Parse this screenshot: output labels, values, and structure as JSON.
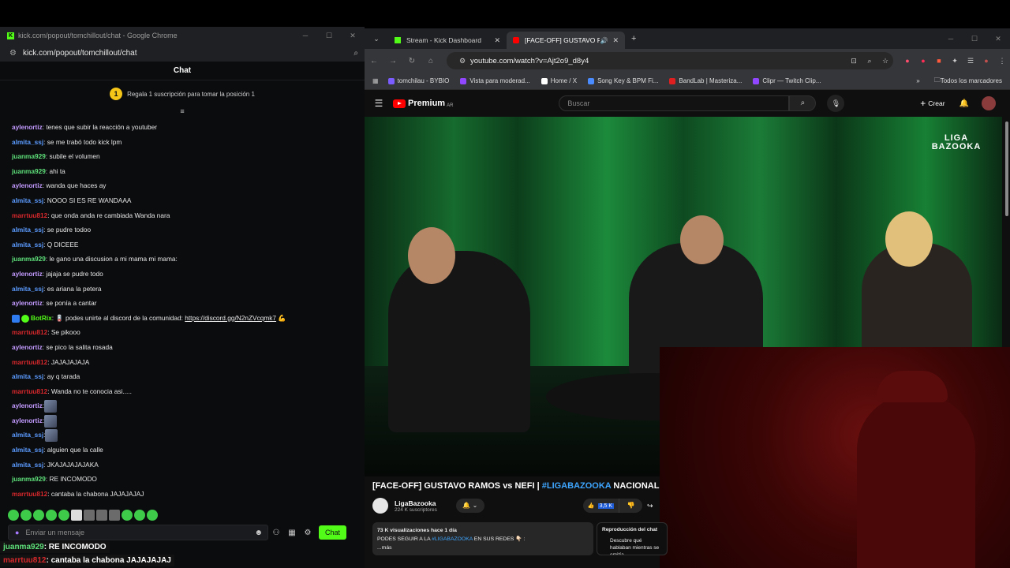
{
  "left_window": {
    "title": "kick.com/popout/tomchillout/chat - Google Chrome",
    "url": "kick.com/popout/tomchillout/chat",
    "chat_header": "Chat",
    "gift_badge": "1",
    "gift_text": "Regala 1 suscripción para tomar la posición 1",
    "messages": [
      {
        "user": "aylenortiz",
        "color": "#c39bff",
        "text": ": tenes que subir la reacción a youtuber"
      },
      {
        "user": "almita_ssj",
        "color": "#5b9bff",
        "text": ": se me trabó todo kick lpm"
      },
      {
        "user": "juanma929",
        "color": "#5ee07a",
        "text": ": subile el volumen"
      },
      {
        "user": "juanma929",
        "color": "#5ee07a",
        "text": ": ahi ta"
      },
      {
        "user": "aylenortiz",
        "color": "#c39bff",
        "text": ": wanda que haces ay"
      },
      {
        "user": "almita_ssj",
        "color": "#5b9bff",
        "text": ": NOOO SI ES RE WANDAAA"
      },
      {
        "user": "marrtuu812",
        "color": "#d8282c",
        "text": ": que onda anda re cambiada Wanda nara"
      },
      {
        "user": "almita_ssj",
        "color": "#5b9bff",
        "text": ": se pudre todoo"
      },
      {
        "user": "almita_ssj",
        "color": "#5b9bff",
        "text": ": Q DICEEE"
      },
      {
        "user": "juanma929",
        "color": "#5ee07a",
        "text": ": le gano una discusion a mi mama mi mama:"
      },
      {
        "user": "aylenortiz",
        "color": "#c39bff",
        "text": ": jajaja se pudre todo"
      },
      {
        "user": "almita_ssj",
        "color": "#5b9bff",
        "text": ": es ariana la petera"
      },
      {
        "user": "aylenortiz",
        "color": "#c39bff",
        "text": ": se ponía a cantar"
      },
      {
        "user": "BotRix",
        "color": "#53fc18",
        "text": ": 🪫 podes unirte al discord de la comunidad: ",
        "link": "https://discord.gg/N2nZVcqmk7",
        "after": " 💪",
        "bot": true
      },
      {
        "user": "marrtuu812",
        "color": "#d8282c",
        "text": ": Se pikooo"
      },
      {
        "user": "aylenortiz",
        "color": "#c39bff",
        "text": ": se pico la salita rosada"
      },
      {
        "user": "marrtuu812",
        "color": "#d8282c",
        "text": ": JAJAJAJAJA"
      },
      {
        "user": "almita_ssj",
        "color": "#5b9bff",
        "text": ": ay q tarada"
      },
      {
        "user": "marrtuu812",
        "color": "#d8282c",
        "text": ": Wanda no te conocia asi....."
      },
      {
        "user": "aylenortiz",
        "color": "#c39bff",
        "text": ":",
        "emote": true
      },
      {
        "user": "aylenortiz",
        "color": "#c39bff",
        "text": ":",
        "emote": true
      },
      {
        "user": "almita_ssj",
        "color": "#5b9bff",
        "text": ":",
        "emote": true
      },
      {
        "user": "almita_ssj",
        "color": "#5b9bff",
        "text": ": alguien que la calle"
      },
      {
        "user": "almita_ssj",
        "color": "#5b9bff",
        "text": ": JKAJAJAJAJAKA"
      },
      {
        "user": "juanma929",
        "color": "#5ee07a",
        "text": ": RE INCOMODO"
      },
      {
        "user": "marrtuu812",
        "color": "#d8282c",
        "text": ": cantaba la chabona JAJAJAJAJ"
      }
    ],
    "input_placeholder": "Enviar un mensaje",
    "send_label": "Chat"
  },
  "captions": [
    {
      "user": "juanma929",
      "color": "#5ee07a",
      "text": ": RE INCOMODO"
    },
    {
      "user": "marrtuu812",
      "color": "#d8282c",
      "text": ": cantaba la chabona JAJAJAJAJ"
    }
  ],
  "right_window": {
    "tabs": [
      {
        "label": "Stream - Kick Dashboard",
        "favicon_color": "#53fc18",
        "active": false
      },
      {
        "label": "[FACE-OFF] GUSTAVO RAMOS vs NEFI",
        "favicon_color": "#ff0000",
        "active": true
      }
    ],
    "url": "youtube.com/watch?v=Ajt2o9_d8y4",
    "bookmarks": [
      {
        "label": "tomchilau - BYBIO",
        "color": "#7b5cff"
      },
      {
        "label": "Vista para moderad...",
        "color": "#9146ff"
      },
      {
        "label": "Home / X",
        "color": "#ffffff"
      },
      {
        "label": "Song Key & BPM Fi...",
        "color": "#4a8cff"
      },
      {
        "label": "BandLab | Masteriza...",
        "color": "#e02020"
      },
      {
        "label": "Clipr — Twitch Clip...",
        "color": "#9146ff"
      }
    ],
    "bookmarks_folder": "Todos los marcadores"
  },
  "youtube": {
    "logo_text": "Premium",
    "logo_country": "AR",
    "search_placeholder": "Buscar",
    "create_label": "Crear",
    "overlay_logo": "LIGA BAZOOKA",
    "title_prefix": "[FACE-OFF] GUSTAVO RAMOS vs NEFI | ",
    "title_tag": "#LIGABAZOOKA",
    "title_suffix": " NACIONAL ARGENT",
    "channel_name": "LigaBazooka",
    "channel_subs": "224 K suscriptores",
    "likes": "3,5 K",
    "desc_stats": "73 K visualizaciones  hace 1 día",
    "desc_prefix": "PODES SEGUIR A LA ",
    "desc_tag": "#LIGABAZOOKA",
    "desc_suffix": " EN SUS REDES 👇🏻 :",
    "desc_more": "...más",
    "replay_title": "Reproducción del chat",
    "replay_text": "Descubre qué hablaban mientras se emitía"
  },
  "icons": {
    "minimize": "minimize-icon",
    "maximize": "maximize-icon",
    "close": "close-icon",
    "search": "search-icon",
    "mic": "mic-icon",
    "bell": "bell-icon",
    "like": "thumb-up-icon",
    "dislike": "thumb-down-icon",
    "share": "share-icon"
  }
}
